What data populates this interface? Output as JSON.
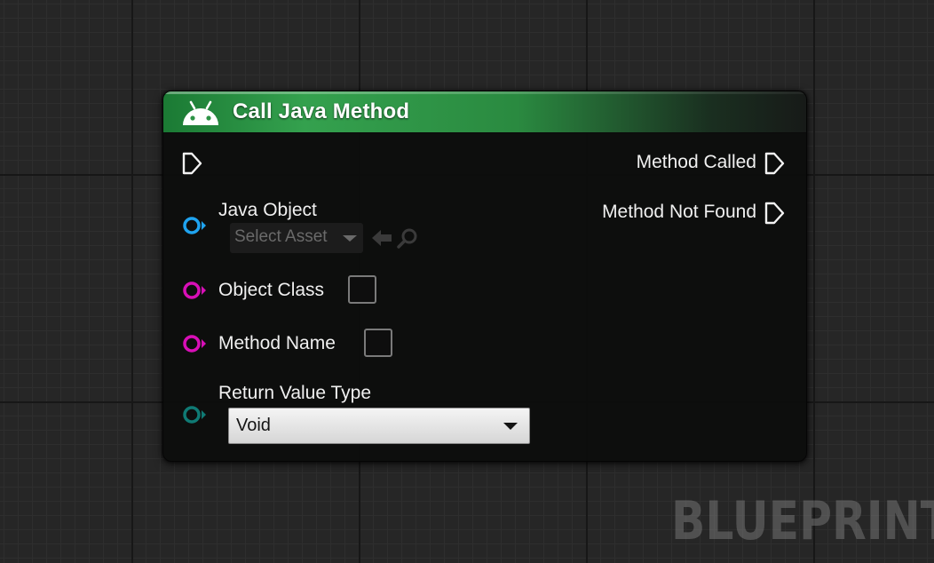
{
  "node": {
    "title": "Call Java Method",
    "header_color": "#34a14e",
    "icon": "android-icon"
  },
  "outputs": [
    {
      "label": "Method Called",
      "pin": "exec-pin"
    },
    {
      "label": "Method Not Found",
      "pin": "exec-pin"
    }
  ],
  "inputs": {
    "java_object": {
      "label": "Java Object",
      "picker_placeholder": "Select Asset",
      "pin_color": "#1fa3ef"
    },
    "object_class": {
      "label": "Object Class",
      "pin_color": "#d80fb7"
    },
    "method_name": {
      "label": "Method Name",
      "pin_color": "#d80fb7"
    },
    "return_value_type": {
      "label": "Return Value Type",
      "selected": "Void",
      "pin_color": "#0f7a74"
    }
  },
  "watermark": "BLUEPRINT"
}
